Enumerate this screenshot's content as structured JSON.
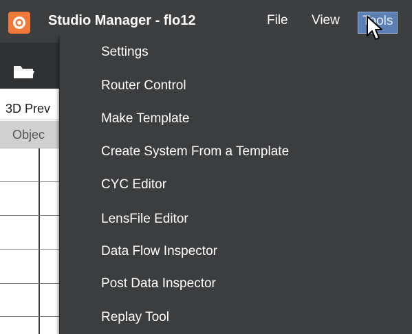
{
  "app": {
    "title": "Studio Manager - flo12"
  },
  "menubar": {
    "items": [
      "File",
      "View",
      "Tools"
    ]
  },
  "left_panel": {
    "tab_label": "3D Prev",
    "column_header": "Objec"
  },
  "tools_menu": {
    "items": [
      "Settings",
      "Router Control",
      "Make Template",
      "Create System From a Template",
      "CYC Editor",
      "LensFile Editor",
      "Data Flow Inspector",
      "Post Data Inspector",
      "Replay Tool"
    ]
  },
  "icons": {
    "app": "app-logo-icon",
    "open": "folder-icon",
    "cursor": "mouse-pointer-icon"
  },
  "colors": {
    "app_icon": "#f07838",
    "menu_background": "#3b3d3f",
    "active_menu": "#5b7fb5"
  }
}
